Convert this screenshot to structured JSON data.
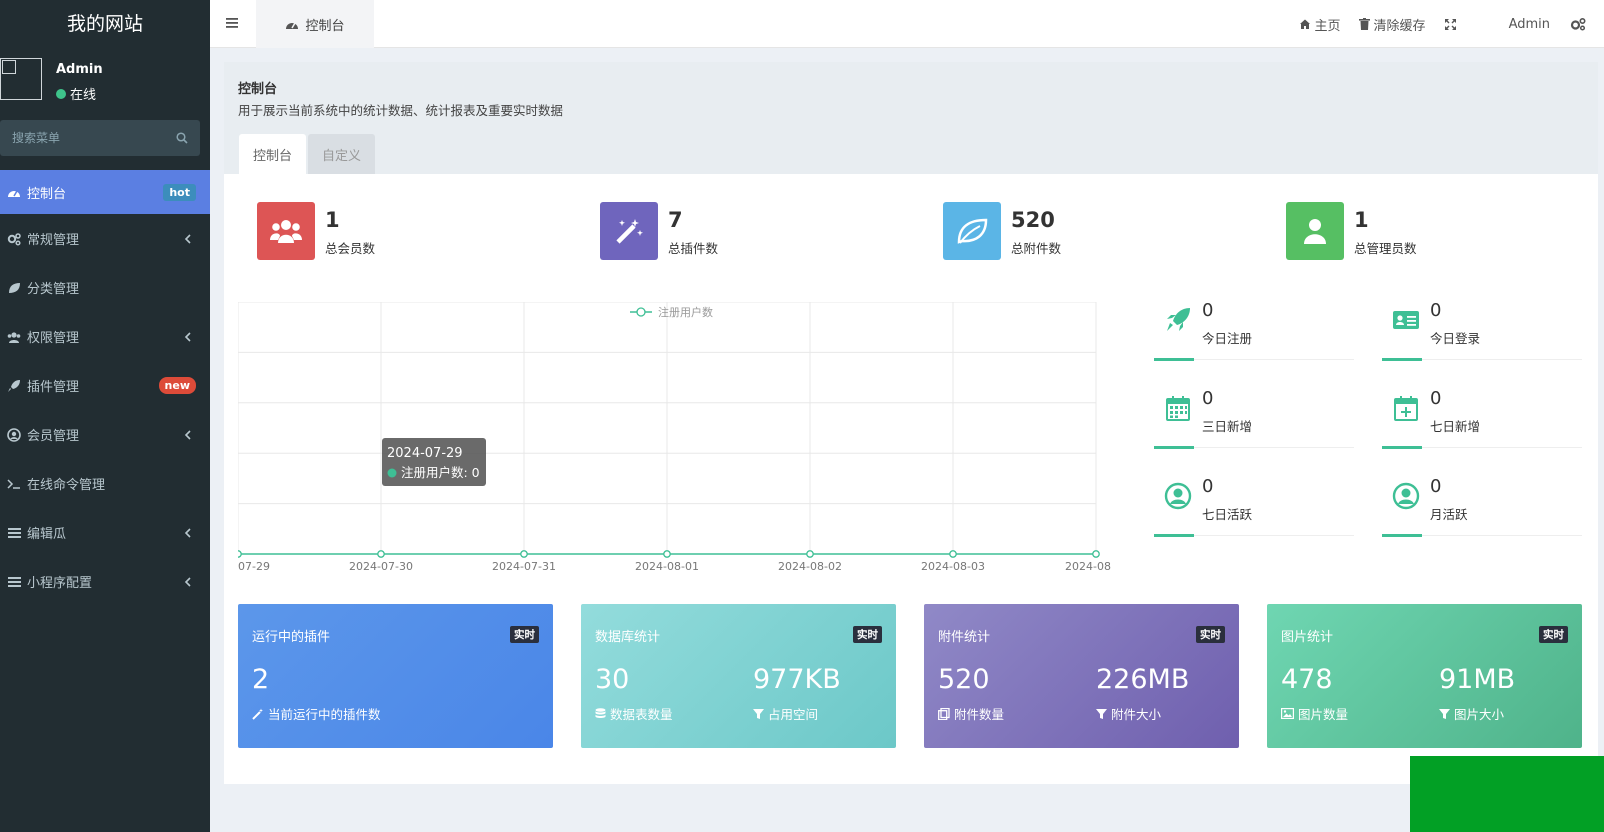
{
  "site": {
    "name": "我的网站"
  },
  "user": {
    "name": "Admin",
    "status": "在线"
  },
  "search": {
    "placeholder": "搜索菜单"
  },
  "menu": [
    {
      "label": "控制台",
      "icon": "dashboard-icon",
      "badge": "hot"
    },
    {
      "label": "常规管理",
      "icon": "cogs-icon"
    },
    {
      "label": "分类管理",
      "icon": "leaf-icon"
    },
    {
      "label": "权限管理",
      "icon": "group-icon"
    },
    {
      "label": "插件管理",
      "icon": "rocket-icon",
      "badge": "new"
    },
    {
      "label": "会员管理",
      "icon": "user-circle-icon"
    },
    {
      "label": "在线命令管理",
      "icon": "terminal-icon"
    },
    {
      "label": "编辑瓜",
      "icon": "list-icon"
    },
    {
      "label": "小程序配置",
      "icon": "list-icon"
    }
  ],
  "header": {
    "tab": "控制台",
    "home": "主页",
    "clear_cache": "清除缓存",
    "admin": "Admin"
  },
  "page": {
    "title": "控制台",
    "description": "用于展示当前系统中的统计数据、统计报表及重要实时数据",
    "tabs": [
      "控制台",
      "自定义"
    ]
  },
  "stats": [
    {
      "value": "1",
      "label": "总会员数",
      "icon": "users-icon",
      "color": "#dd5555"
    },
    {
      "value": "7",
      "label": "总插件数",
      "icon": "magic-icon",
      "color": "#6f65bd"
    },
    {
      "value": "520",
      "label": "总附件数",
      "icon": "leaf-icon",
      "color": "#5bb5e6"
    },
    {
      "value": "1",
      "label": "总管理员数",
      "icon": "user-icon",
      "color": "#56bf63"
    }
  ],
  "chart_data": {
    "type": "line",
    "legend": "注册用户数",
    "categories": [
      "2024-07-29",
      "2024-07-30",
      "2024-07-31",
      "2024-08-01",
      "2024-08-02",
      "2024-08-03",
      "2024-08-04"
    ],
    "tick_labels": [
      "07-29",
      "2024-07-30",
      "2024-07-31",
      "2024-08-01",
      "2024-08-02",
      "2024-08-03",
      "2024-08"
    ],
    "series": [
      {
        "name": "注册用户数",
        "values": [
          0,
          0,
          0,
          0,
          0,
          0,
          0
        ]
      }
    ],
    "tooltip": {
      "date": "2024-07-29",
      "text": "注册用户数: 0"
    },
    "color": "#3ebf95"
  },
  "mini_stats": [
    {
      "value": "0",
      "label": "今日注册",
      "icon": "rocket-icon"
    },
    {
      "value": "0",
      "label": "今日登录",
      "icon": "vcard-icon"
    },
    {
      "value": "0",
      "label": "三日新增",
      "icon": "calendar-icon"
    },
    {
      "value": "0",
      "label": "七日新增",
      "icon": "calendar-plus-icon"
    },
    {
      "value": "0",
      "label": "七日活跃",
      "icon": "user-circle-icon"
    },
    {
      "value": "0",
      "label": "月活跃",
      "icon": "user-circle-icon"
    }
  ],
  "cards": [
    {
      "title": "运行中的插件",
      "tag": "实时",
      "items": [
        {
          "value": "2",
          "label": "当前运行中的插件数",
          "icon": "magic-icon"
        }
      ]
    },
    {
      "title": "数据库统计",
      "tag": "实时",
      "items": [
        {
          "value": "30",
          "label": "数据表数量",
          "icon": "database-icon"
        },
        {
          "value": "977KB",
          "label": "占用空间",
          "icon": "filter-icon"
        }
      ]
    },
    {
      "title": "附件统计",
      "tag": "实时",
      "items": [
        {
          "value": "520",
          "label": "附件数量",
          "icon": "files-icon"
        },
        {
          "value": "226MB",
          "label": "附件大小",
          "icon": "filter-icon"
        }
      ]
    },
    {
      "title": "图片统计",
      "tag": "实时",
      "items": [
        {
          "value": "478",
          "label": "图片数量",
          "icon": "image-icon"
        },
        {
          "value": "91MB",
          "label": "图片大小",
          "icon": "filter-icon"
        }
      ]
    }
  ]
}
